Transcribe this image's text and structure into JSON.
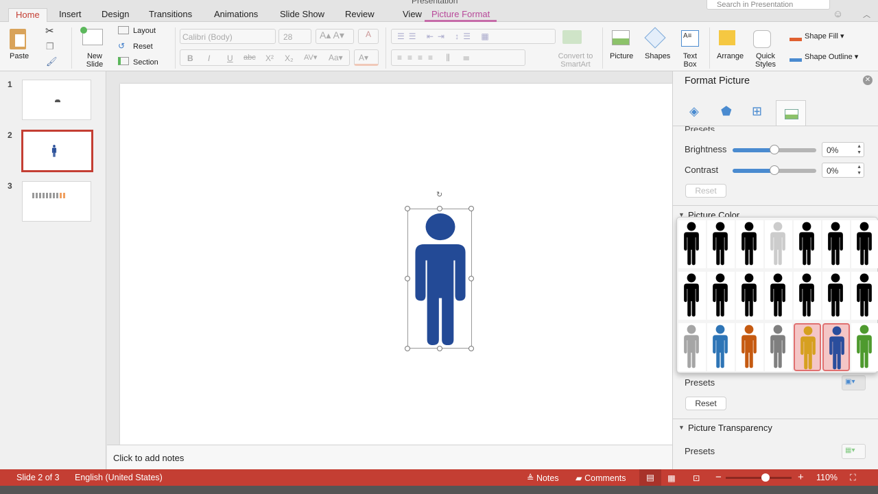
{
  "app": {
    "title": "Presentation",
    "search_placeholder": "Search in Presentation"
  },
  "tabs": [
    "Home",
    "Insert",
    "Design",
    "Transitions",
    "Animations",
    "Slide Show",
    "Review",
    "View",
    "Picture Format"
  ],
  "active_tab": "Home",
  "ribbon": {
    "paste": "Paste",
    "new_slide": "New Slide",
    "layout": "Layout",
    "reset": "Reset",
    "section": "Section",
    "font": "Calibri (Body)",
    "font_size": "28",
    "format_buttons": [
      "B",
      "I",
      "U",
      "abc",
      "X²",
      "X₂"
    ],
    "convert": "Convert to SmartArt",
    "picture": "Picture",
    "shapes": "Shapes",
    "text_box": "Text Box",
    "arrange": "Arrange",
    "quick_styles": "Quick Styles",
    "shape_fill": "Shape Fill",
    "shape_outline": "Shape Outline"
  },
  "slides": [
    {
      "number": "1"
    },
    {
      "number": "2",
      "selected": true
    },
    {
      "number": "3"
    }
  ],
  "notes_placeholder": "Click to add notes",
  "pane": {
    "title": "Format Picture",
    "tabs": [
      "fill-line-icon",
      "effects-icon",
      "size-properties-icon",
      "picture-icon"
    ],
    "presets_label": "Presets",
    "brightness_label": "Brightness",
    "brightness_value": "0%",
    "brightness_level": 0,
    "contrast_label": "Contrast",
    "contrast_value": "0%",
    "contrast_level": 0,
    "reset": "Reset",
    "picture_color": "Picture Color",
    "picture_transparency": "Picture Transparency",
    "gallery": [
      [
        "#000000",
        "#000000",
        "#000000",
        "#cccccc",
        "#000000",
        "#000000",
        "#000000"
      ],
      [
        "#000000",
        "#000000",
        "#000000",
        "#000000",
        "#000000",
        "#000000",
        "#000000"
      ],
      [
        "#a5a5a5",
        "#2e75b6",
        "#c55a11",
        "#7f7f7f",
        "#d6a020",
        "#2a4d9c",
        "#4e9a2e"
      ]
    ],
    "gallery_highlighted": [
      [
        2,
        4
      ],
      [
        2,
        5
      ]
    ]
  },
  "figure_color": "#234a96",
  "status": {
    "slide": "Slide 2 of 3",
    "language": "English (United States)",
    "notes": "Notes",
    "comments": "Comments",
    "zoom": "110%",
    "zoom_level": 0.6,
    "bar_color": "#c43e33"
  }
}
